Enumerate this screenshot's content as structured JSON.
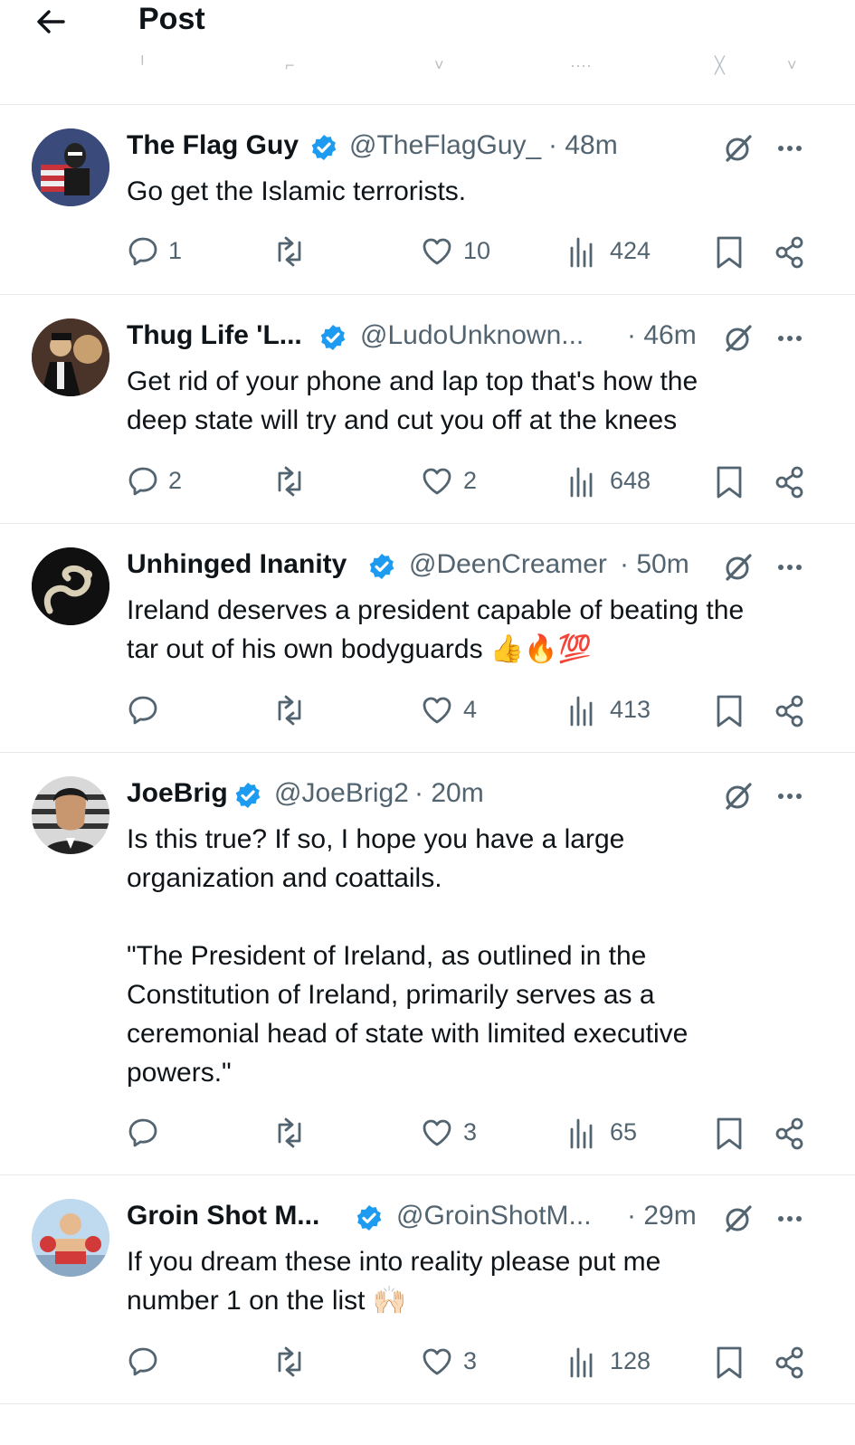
{
  "header": {
    "title": "Post"
  },
  "colors": {
    "verified": "#1d9bf0",
    "icon": "#536471",
    "text": "#0f1419"
  },
  "tweets": [
    {
      "name": "The Flag Guy",
      "handle": "@TheFlagGuy_",
      "time": "· 48m",
      "paragraphs": [
        "Go get the Islamic terrorists."
      ],
      "replies": "1",
      "reposts": "",
      "likes": "10",
      "views": "424"
    },
    {
      "name": "Thug Life 'L...",
      "handle": "@LudoUnknown...",
      "time": "· 46m",
      "paragraphs": [
        "Get rid of your phone and lap top that's how the\ndeep state will try and cut you off at the knees"
      ],
      "replies": "2",
      "reposts": "",
      "likes": "2",
      "views": "648"
    },
    {
      "name": "Unhinged Inanity",
      "handle": "@DeenCreamer",
      "time": "· 50m",
      "paragraphs": [
        "Ireland deserves a president capable of beating the\ntar out of his own bodyguards 👍🔥💯"
      ],
      "replies": "",
      "reposts": "",
      "likes": "4",
      "views": "413"
    },
    {
      "name": "JoeBrig",
      "handle": "@JoeBrig2",
      "time": "· 20m",
      "paragraphs": [
        "Is this true? If so, I hope you have a large\norganization and coattails.",
        "\"The President of Ireland, as outlined in the\nConstitution of Ireland, primarily serves as a\nceremonial head of state with limited executive\npowers.\""
      ],
      "replies": "",
      "reposts": "",
      "likes": "3",
      "views": "65"
    },
    {
      "name": "Groin Shot M...",
      "handle": "@GroinShotM...",
      "time": "· 29m",
      "paragraphs": [
        "If you dream these into reality please put me\nnumber 1 on the list 🙌🏻"
      ],
      "replies": "",
      "reposts": "",
      "likes": "3",
      "views": "128"
    }
  ]
}
